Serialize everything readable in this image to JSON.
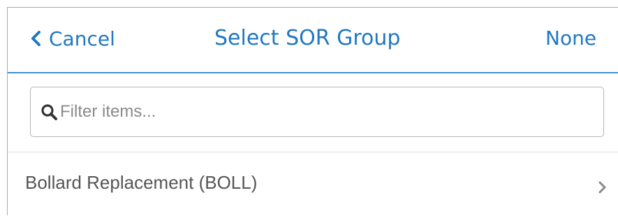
{
  "header": {
    "cancel_label": "Cancel",
    "title": "Select SOR Group",
    "none_label": "None"
  },
  "filter": {
    "placeholder": "Filter items...",
    "value": ""
  },
  "list": {
    "items": [
      {
        "label": "Bollard Replacement (BOLL)"
      }
    ]
  },
  "icons": {
    "back": "chevron-left-icon",
    "search": "search-icon",
    "item_arrow": "chevron-right-icon"
  },
  "colors": {
    "accent": "#1f78c1",
    "header_border": "#3d8fd4",
    "item_text": "#555555",
    "placeholder": "#8a8a8a"
  }
}
